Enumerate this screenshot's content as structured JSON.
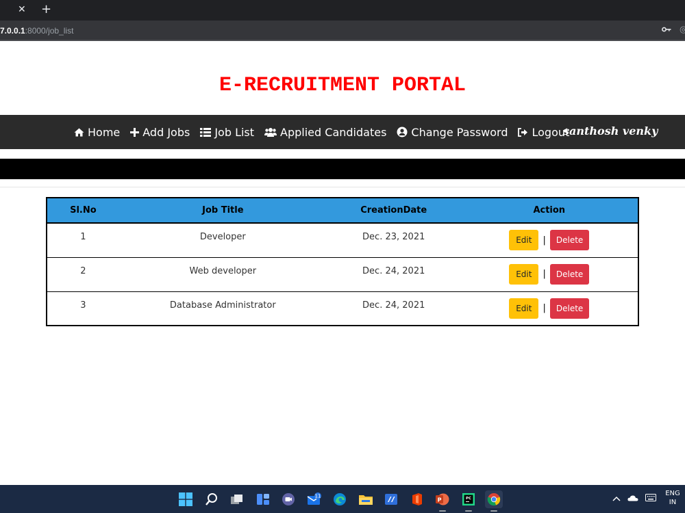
{
  "browser": {
    "url_host": "7.0.0.1",
    "url_path": ":8000/job_list"
  },
  "header": {
    "title": "E-RECRUITMENT PORTAL"
  },
  "nav": {
    "items": [
      {
        "label": "Home",
        "icon": "home-icon"
      },
      {
        "label": "Add Jobs",
        "icon": "plus-icon"
      },
      {
        "label": "Job List",
        "icon": "list-icon"
      },
      {
        "label": "Applied Candidates",
        "icon": "users-icon"
      },
      {
        "label": "Change Password",
        "icon": "user-circle-icon"
      },
      {
        "label": "Logout",
        "icon": "logout-icon"
      }
    ],
    "user": "santhosh venky"
  },
  "table": {
    "headers": [
      "Sl.No",
      "Job Title",
      "CreationDate",
      "Action"
    ],
    "rows": [
      {
        "sl": "1",
        "title": "Developer",
        "date": "Dec. 23, 2021"
      },
      {
        "sl": "2",
        "title": "Web developer",
        "date": "Dec. 24, 2021"
      },
      {
        "sl": "3",
        "title": "Database Administrator",
        "date": "Dec. 24, 2021"
      }
    ],
    "edit_label": "Edit",
    "delete_label": "Delete",
    "separator": "|"
  },
  "taskbar": {
    "mail_badge": "11",
    "lang_line1": "ENG",
    "lang_line2": "IN"
  },
  "colors": {
    "title": "#ff0000",
    "navbar": "#2b2b2b",
    "table_header": "#3399dd",
    "edit": "#ffc107",
    "delete": "#dc3545",
    "taskbar": "#1b2a44"
  }
}
